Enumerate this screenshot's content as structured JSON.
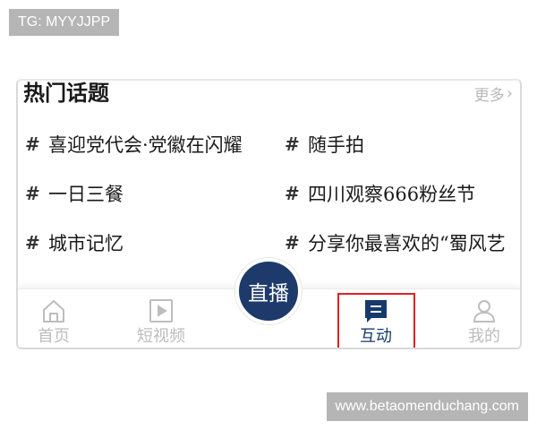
{
  "watermarks": {
    "top": "TG: MYYJJPP",
    "bottom": "www.betaomenduchang.com"
  },
  "topics": {
    "title": "热门话题",
    "more_label": "更多",
    "hash_symbol": "#",
    "items": [
      {
        "label": "喜迎党代会·党徽在闪耀"
      },
      {
        "label": "随手拍"
      },
      {
        "label": "一日三餐"
      },
      {
        "label": "四川观察666粉丝节"
      },
      {
        "label": "城市记忆"
      },
      {
        "label": "分享你最喜欢的“蜀风艺"
      }
    ]
  },
  "tabbar": {
    "tabs": [
      {
        "label": "首页",
        "icon": "home-icon"
      },
      {
        "label": "短视频",
        "icon": "play-icon"
      },
      {
        "label": "互动",
        "icon": "chat-icon",
        "active": true
      },
      {
        "label": "我的",
        "icon": "user-icon"
      }
    ],
    "live_label": "直播"
  },
  "colors": {
    "accent": "#1d3a6a",
    "inactive": "#bdbdbd",
    "highlight": "#e02020"
  }
}
